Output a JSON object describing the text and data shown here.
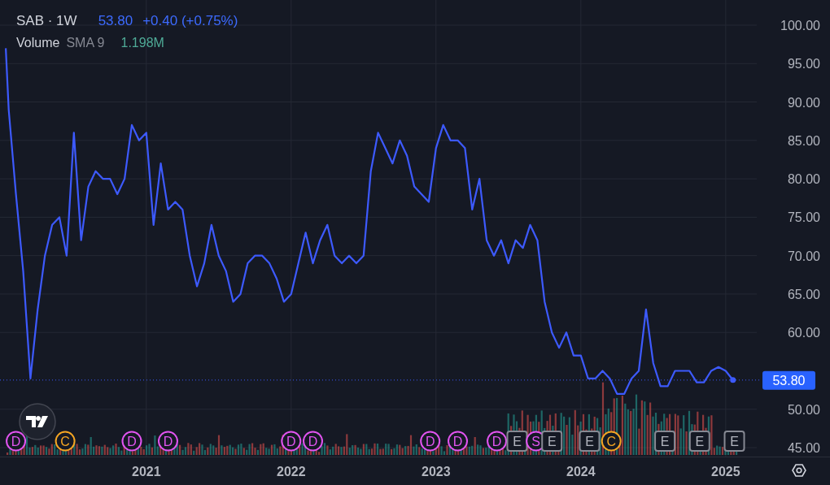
{
  "legend": {
    "symbol": "SAB · 1W",
    "price": "53.80",
    "change": "+0.40 (+0.75%)",
    "indicator": "Volume",
    "indicator_params": "SMA 9",
    "indicator_value": "1.198M"
  },
  "chart": {
    "chart_data": {
      "type": "line",
      "grid": true,
      "xlim": [
        2019.99,
        2025.72
      ],
      "ylim": [
        43.84,
        103.28
      ],
      "x": [
        2020.03,
        2020.05,
        2020.1,
        2020.15,
        2020.2,
        2020.25,
        2020.3,
        2020.35,
        2020.4,
        2020.45,
        2020.5,
        2020.55,
        2020.6,
        2020.65,
        2020.7,
        2020.75,
        2020.8,
        2020.85,
        2020.9,
        2020.95,
        2021.0,
        2021.05,
        2021.1,
        2021.15,
        2021.2,
        2021.25,
        2021.3,
        2021.35,
        2021.4,
        2021.45,
        2021.5,
        2021.55,
        2021.6,
        2021.65,
        2021.7,
        2021.75,
        2021.8,
        2021.85,
        2021.9,
        2021.95,
        2022.0,
        2022.05,
        2022.1,
        2022.15,
        2022.2,
        2022.25,
        2022.3,
        2022.35,
        2022.4,
        2022.45,
        2022.5,
        2022.55,
        2022.6,
        2022.65,
        2022.7,
        2022.75,
        2022.8,
        2022.85,
        2022.9,
        2022.95,
        2023.0,
        2023.05,
        2023.1,
        2023.15,
        2023.2,
        2023.25,
        2023.3,
        2023.35,
        2023.4,
        2023.45,
        2023.5,
        2023.55,
        2023.6,
        2023.65,
        2023.7,
        2023.75,
        2023.8,
        2023.85,
        2023.9,
        2023.95,
        2024.0,
        2024.05,
        2024.1,
        2024.15,
        2024.2,
        2024.25,
        2024.3,
        2024.35,
        2024.4,
        2024.45,
        2024.5,
        2024.55,
        2024.6,
        2024.65,
        2024.7,
        2024.75,
        2024.8,
        2024.85,
        2024.9,
        2024.95,
        2025.0,
        2025.05
      ],
      "series": [
        {
          "color": "#3d5afe",
          "values": [
            97,
            89,
            78,
            68,
            54,
            63,
            70,
            74,
            75,
            70,
            86,
            72,
            79,
            81,
            80,
            80,
            78,
            80,
            87,
            85,
            86,
            74,
            82,
            76,
            77,
            76,
            70,
            66,
            69,
            74,
            70,
            68,
            64,
            65,
            69,
            70,
            70,
            69,
            67,
            64,
            65,
            69,
            73,
            69,
            72,
            74,
            70,
            69,
            70,
            69,
            70,
            81,
            86,
            84,
            82,
            85,
            83,
            79,
            78,
            77,
            84,
            87,
            85,
            85,
            84,
            76,
            80,
            72,
            70,
            72,
            69,
            72,
            71,
            74,
            72,
            64,
            60,
            58,
            60,
            57,
            57,
            54,
            54,
            55,
            54,
            52,
            52,
            54,
            55,
            63,
            56,
            53,
            53,
            55,
            55,
            55,
            53.5,
            53.5,
            55,
            55.5,
            55,
            53.8
          ]
        }
      ],
      "xticks": [
        {
          "value": 2021,
          "label": "2021"
        },
        {
          "value": 2022,
          "label": "2022"
        },
        {
          "value": 2023,
          "label": "2023"
        },
        {
          "value": 2024,
          "label": "2024"
        },
        {
          "value": 2025,
          "label": "2025"
        }
      ],
      "yticks": [
        {
          "value": 100,
          "label": "100.00"
        },
        {
          "value": 95,
          "label": "95.00"
        },
        {
          "value": 90,
          "label": "90.00"
        },
        {
          "value": 85,
          "label": "85.00"
        },
        {
          "value": 80,
          "label": "80.00"
        },
        {
          "value": 75,
          "label": "75.00"
        },
        {
          "value": 70,
          "label": "70.00"
        },
        {
          "value": 65,
          "label": "65.00"
        },
        {
          "value": 60,
          "label": "60.00"
        },
        {
          "value": 50,
          "label": "50.00"
        },
        {
          "value": 45,
          "label": "45.00"
        }
      ],
      "ref_lines": [
        {
          "axis": "y",
          "value": 53.8,
          "label": "53.80"
        }
      ],
      "annotations": [
        {
          "x": 2020.1,
          "text": "D"
        },
        {
          "x": 2020.44,
          "text": "C"
        },
        {
          "x": 2020.9,
          "text": "D"
        },
        {
          "x": 2021.15,
          "text": "D"
        },
        {
          "x": 2022.0,
          "text": "D"
        },
        {
          "x": 2022.15,
          "text": "D"
        },
        {
          "x": 2022.96,
          "text": "D"
        },
        {
          "x": 2023.15,
          "text": "D"
        },
        {
          "x": 2023.42,
          "text": "D"
        },
        {
          "x": 2023.56,
          "text": "E"
        },
        {
          "x": 2023.69,
          "text": "S"
        },
        {
          "x": 2023.8,
          "text": "E"
        },
        {
          "x": 2024.06,
          "text": "E"
        },
        {
          "x": 2024.21,
          "text": "C"
        },
        {
          "x": 2024.58,
          "text": "E"
        },
        {
          "x": 2024.82,
          "text": "E"
        },
        {
          "x": 2025.06,
          "text": "E"
        }
      ]
    },
    "event_markers": [
      {
        "kind": "dividend"
      },
      {
        "kind": "corporate"
      },
      {
        "kind": "dividend"
      },
      {
        "kind": "dividend"
      },
      {
        "kind": "dividend"
      },
      {
        "kind": "dividend"
      },
      {
        "kind": "dividend"
      },
      {
        "kind": "dividend"
      },
      {
        "kind": "dividend"
      },
      {
        "kind": "earnings"
      },
      {
        "kind": "split"
      },
      {
        "kind": "earnings"
      },
      {
        "kind": "earnings"
      },
      {
        "kind": "corporate"
      },
      {
        "kind": "earnings"
      },
      {
        "kind": "earnings"
      },
      {
        "kind": "earnings"
      }
    ]
  }
}
